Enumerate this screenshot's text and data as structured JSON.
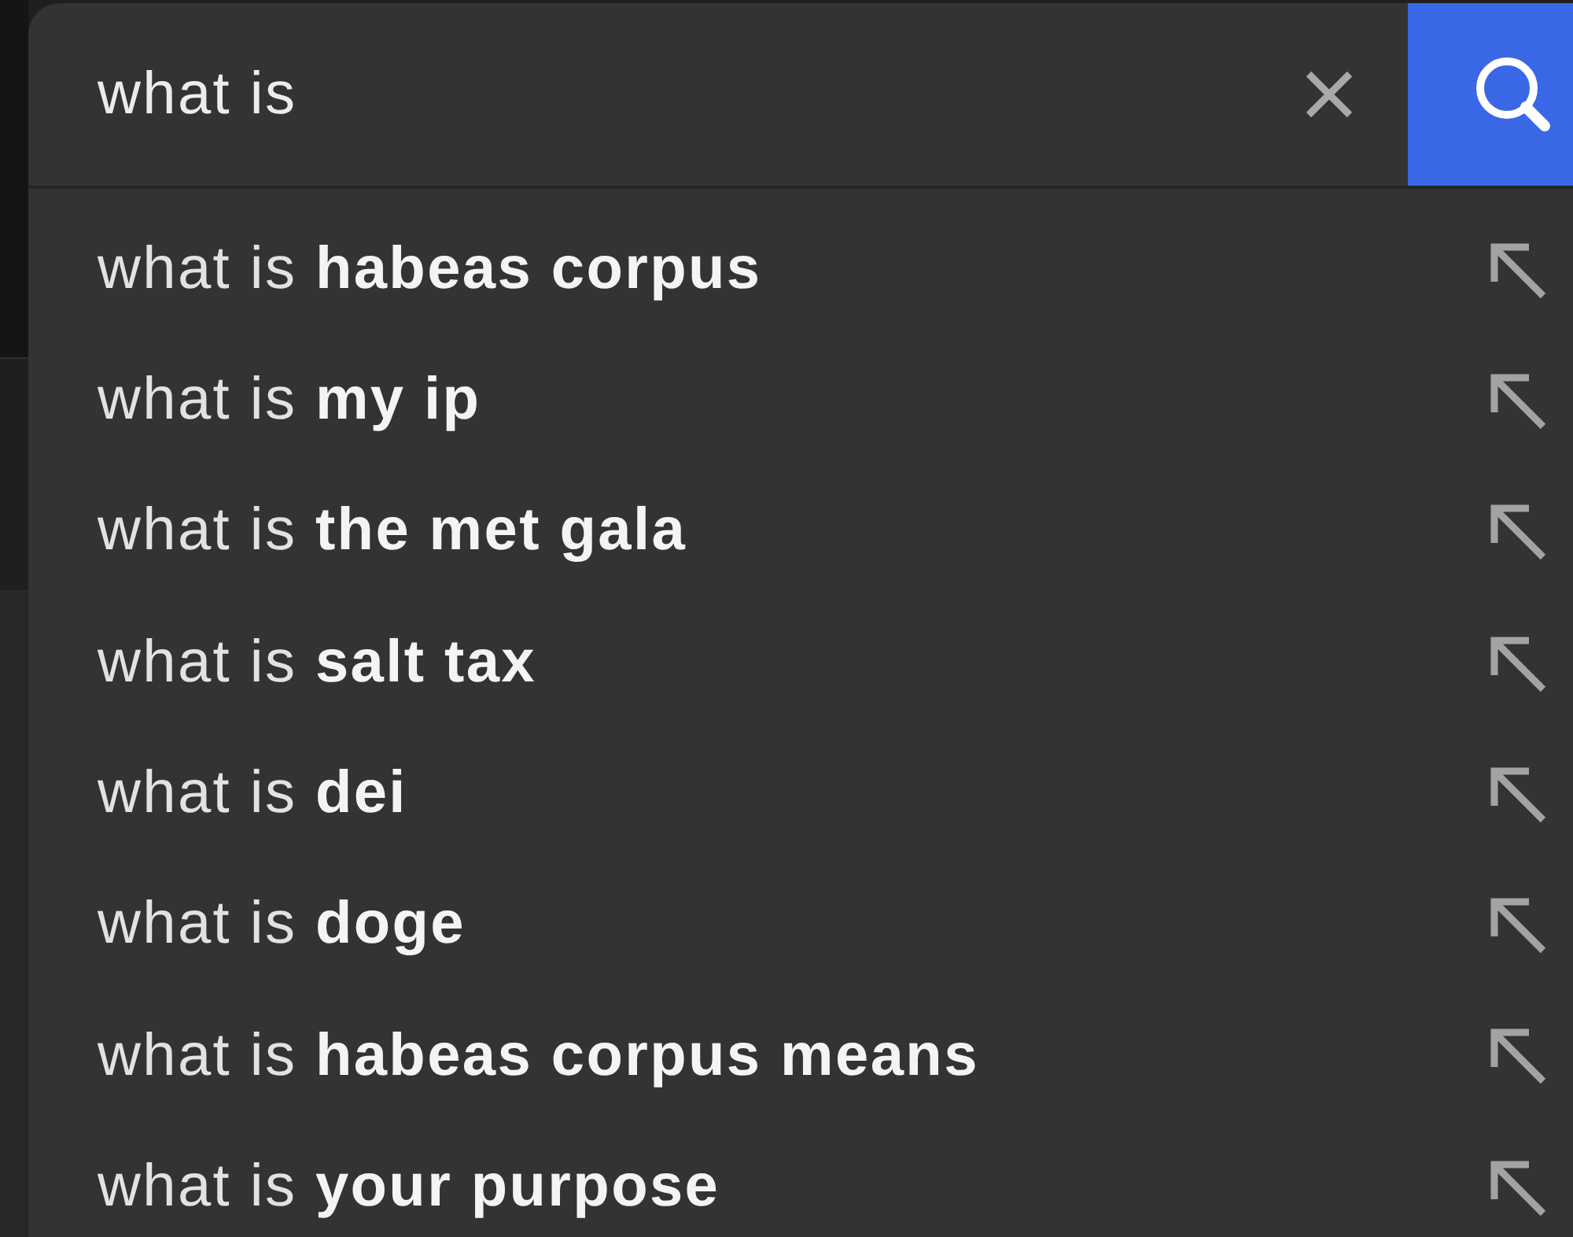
{
  "search": {
    "value": "what is"
  },
  "suggestions": [
    {
      "text": "what is **habeas corpus**"
    },
    {
      "text": "what is **my ip**"
    },
    {
      "text": "what is **the met gala**"
    },
    {
      "text": "what is **salt tax**"
    },
    {
      "text": "what is **dei**"
    },
    {
      "text": "what is **doge**"
    },
    {
      "text": "what is **habeas corpus means**"
    },
    {
      "text": "what is **your purpose**"
    }
  ]
}
